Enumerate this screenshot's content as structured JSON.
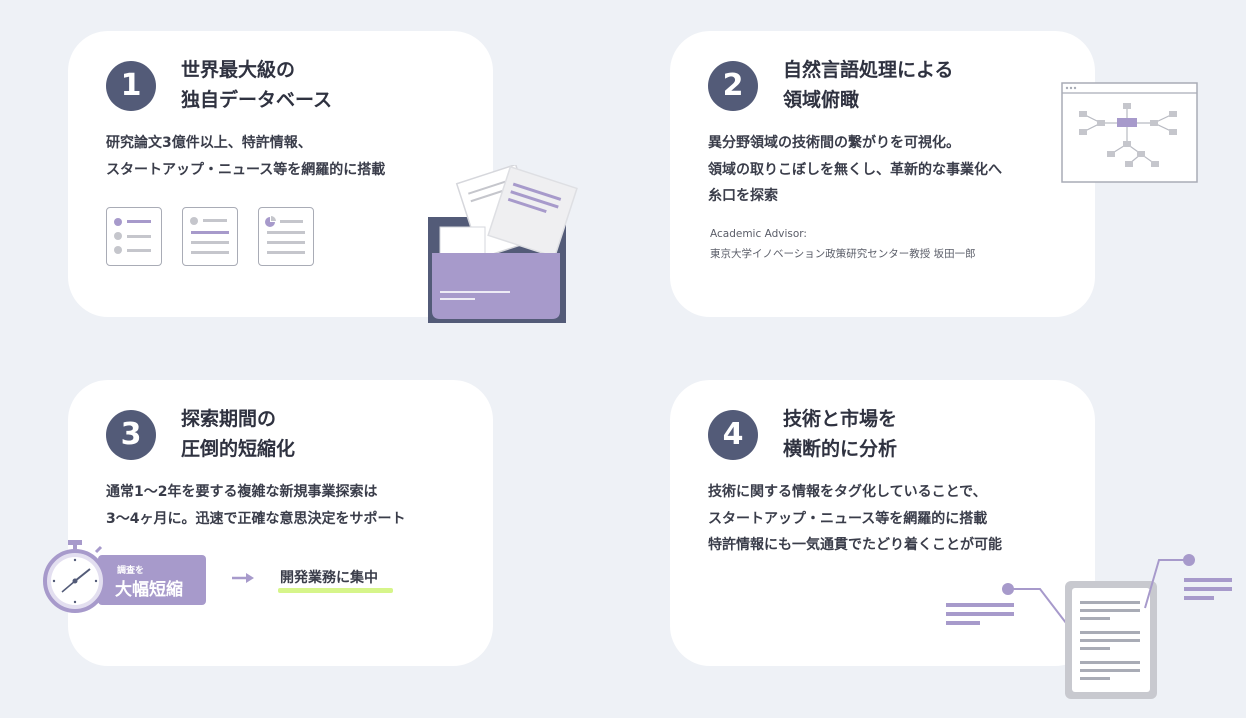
{
  "cards": [
    {
      "number": "1",
      "title_lines": [
        "世界最大級の",
        "独自データベース"
      ],
      "body_lines": [
        "研究論文3億件以上、特許情報、",
        "スタートアップ・ニュース等を網羅的に搭載"
      ]
    },
    {
      "number": "2",
      "title_lines": [
        "自然言語処理による",
        "領域俯瞰"
      ],
      "body_lines": [
        "異分野領域の技術間の繋がりを可視化。",
        "領域の取りこぼしを無くし、革新的な事業化へ",
        "糸口を探索"
      ],
      "advisor_label": "Academic Advisor:",
      "advisor_name": "東京大学イノベーション政策研究センター教授  坂田一郎"
    },
    {
      "number": "3",
      "title_lines": [
        "探索期間の",
        "圧倒的短縮化"
      ],
      "body_lines": [
        "通常1〜2年を要する複雑な新規事業探索は",
        "3〜4ヶ月に。迅速で正確な意思決定をサポート"
      ],
      "badge_small": "調査を",
      "badge_big": "大幅短縮",
      "focus_text": "開発業務に集中"
    },
    {
      "number": "4",
      "title_lines": [
        "技術と市場を",
        "横断的に分析"
      ],
      "body_lines": [
        "技術に関する情報をタグ化していることで、",
        "スタートアップ・ニュース等を網羅的に搭載",
        "特許情報にも一気通貫でたどり着くことが可能"
      ]
    }
  ],
  "colors": {
    "background": "#eef1f6",
    "card": "#ffffff",
    "number_circle": "#535b78",
    "accent_purple": "#a79acb",
    "highlight_green": "#d6f58a"
  },
  "icons": [
    "document-list-icon",
    "document-lines-icon",
    "document-chart-icon",
    "folder-icon",
    "network-diagram-icon",
    "stopwatch-icon",
    "arrow-right-icon",
    "document-tag-icon"
  ]
}
